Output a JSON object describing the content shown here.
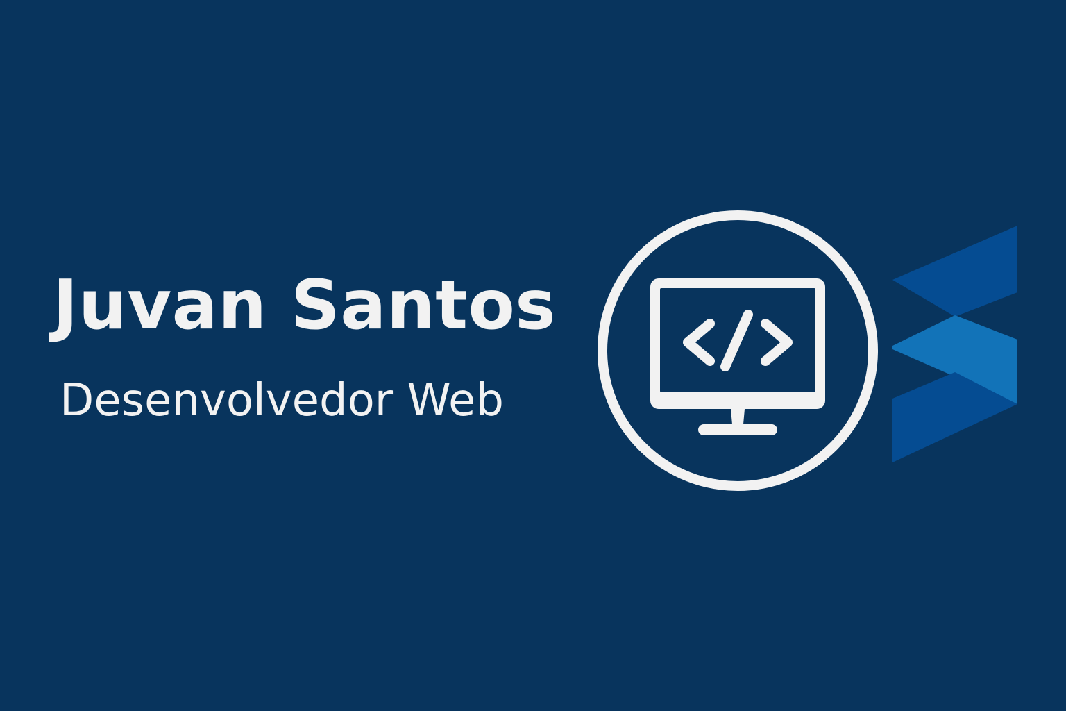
{
  "profile": {
    "name": "Juvan Santos",
    "title": "Desenvolvedor Web"
  },
  "colors": {
    "background": "#08345d",
    "text": "#f2f2f2",
    "logo_dark": "#054c92",
    "logo_light": "#1273b8"
  },
  "icons": {
    "main": "monitor-code-icon",
    "brand": "chevron-logo-icon"
  }
}
